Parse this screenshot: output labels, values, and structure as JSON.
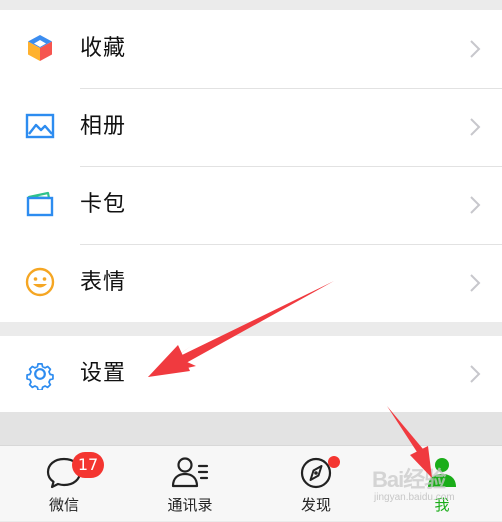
{
  "menu": {
    "items": [
      {
        "label": "收藏",
        "icon": "favorites-cube-icon"
      },
      {
        "label": "相册",
        "icon": "album-picture-icon"
      },
      {
        "label": "卡包",
        "icon": "card-wallet-icon"
      },
      {
        "label": "表情",
        "icon": "sticker-smiley-icon"
      }
    ],
    "settings": {
      "label": "设置",
      "icon": "gear-icon"
    }
  },
  "tabbar": {
    "tabs": [
      {
        "label": "微信",
        "icon": "chat-bubble-icon",
        "badge": "17"
      },
      {
        "label": "通讯录",
        "icon": "contacts-icon"
      },
      {
        "label": "发现",
        "icon": "compass-icon",
        "has_dot": true
      },
      {
        "label": "我",
        "icon": "me-person-icon",
        "active": true
      }
    ]
  },
  "watermark": {
    "text": "Bai经验",
    "url": "jingyan.baidu.com"
  },
  "colors": {
    "accent_green": "#1aad19",
    "badge_red": "#f43530",
    "annotation_red": "#f03a3f",
    "background": "#ebebeb"
  }
}
